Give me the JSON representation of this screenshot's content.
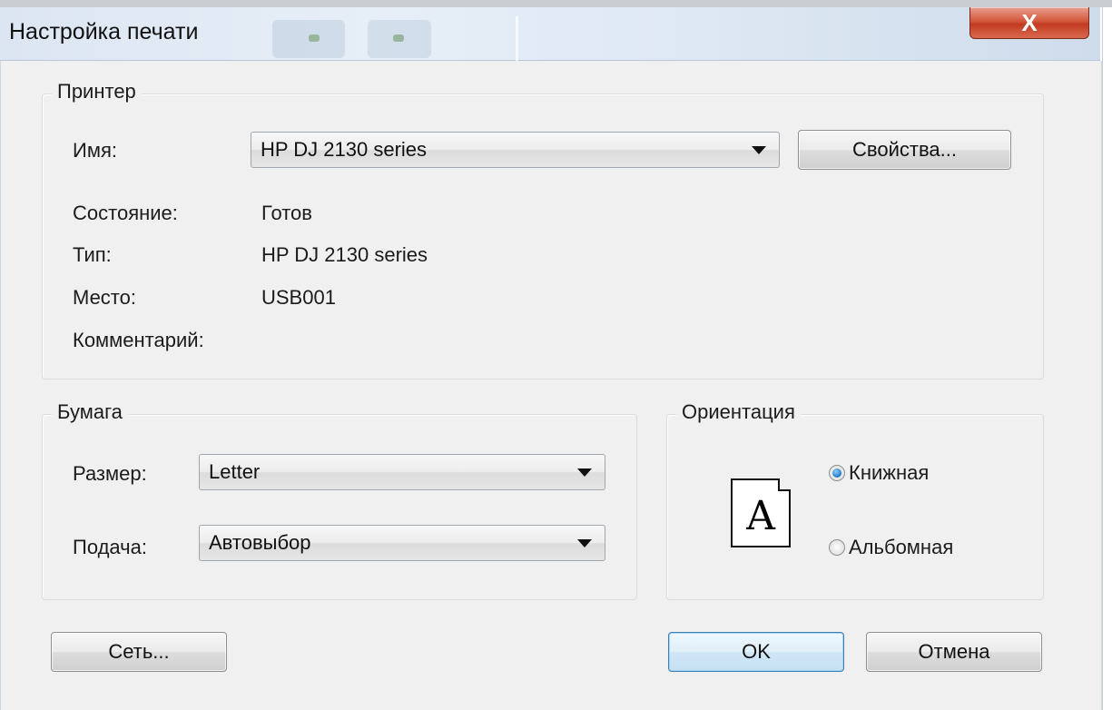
{
  "window": {
    "title": "Настройка печати",
    "close_glyph": "X"
  },
  "printer": {
    "legend": "Принтер",
    "name_label": "Имя:",
    "name_value": "HP DJ 2130 series",
    "properties_button": "Свойства...",
    "status_label": "Состояние:",
    "status_value": "Готов",
    "type_label": "Тип:",
    "type_value": "HP DJ 2130 series",
    "location_label": "Место:",
    "location_value": "USB001",
    "comment_label": "Комментарий:",
    "comment_value": ""
  },
  "paper": {
    "legend": "Бумага",
    "size_label": "Размер:",
    "size_value": "Letter",
    "source_label": "Подача:",
    "source_value": "Автовыбор"
  },
  "orientation": {
    "legend": "Ориентация",
    "preview_glyph": "A",
    "portrait_label": "Книжная",
    "landscape_label": "Альбомная",
    "selected": "portrait"
  },
  "buttons": {
    "network": "Сеть...",
    "ok": "OK",
    "cancel": "Отмена"
  },
  "colors": {
    "close_red": "#c23b21",
    "default_button_border": "#3c7fb1",
    "dialog_background": "#f0f0f0"
  }
}
